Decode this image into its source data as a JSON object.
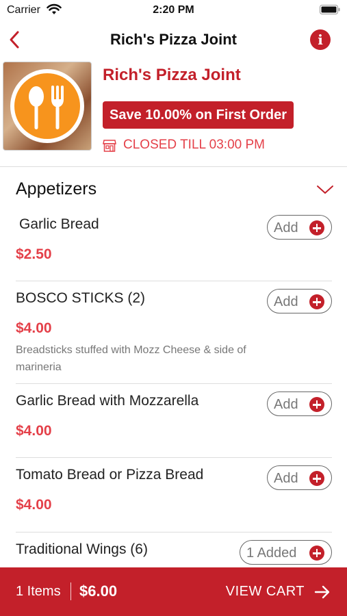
{
  "status_bar": {
    "carrier": "Carrier",
    "time": "2:20 PM"
  },
  "nav": {
    "title": "Rich's Pizza Joint",
    "info_symbol": "i"
  },
  "restaurant": {
    "name": "Rich's Pizza Joint",
    "promo": "Save 10.00% on First Order",
    "status": "CLOSED TILL 03:00 PM"
  },
  "category": {
    "title": "Appetizers"
  },
  "items": [
    {
      "name": "Garlic Bread",
      "price": "$2.50",
      "description": "",
      "button": "Add"
    },
    {
      "name": "BOSCO STICKS (2)",
      "price": "$4.00",
      "description": "Breadsticks stuffed with Mozz Cheese & side of marineria",
      "button": "Add"
    },
    {
      "name": "Garlic Bread with Mozzarella",
      "price": "$4.00",
      "description": "",
      "button": "Add"
    },
    {
      "name": "Tomato Bread or Pizza Bread",
      "price": "$4.00",
      "description": "",
      "button": "Add"
    },
    {
      "name": "Traditional Wings (6)",
      "price": "",
      "description": "",
      "button": "1 Added"
    }
  ],
  "cart": {
    "count": "1 Items",
    "total": "$6.00",
    "action": "VIEW CART"
  },
  "colors": {
    "brand": "#c3202a",
    "price": "#e44049",
    "logo_orange": "#f7941d"
  }
}
